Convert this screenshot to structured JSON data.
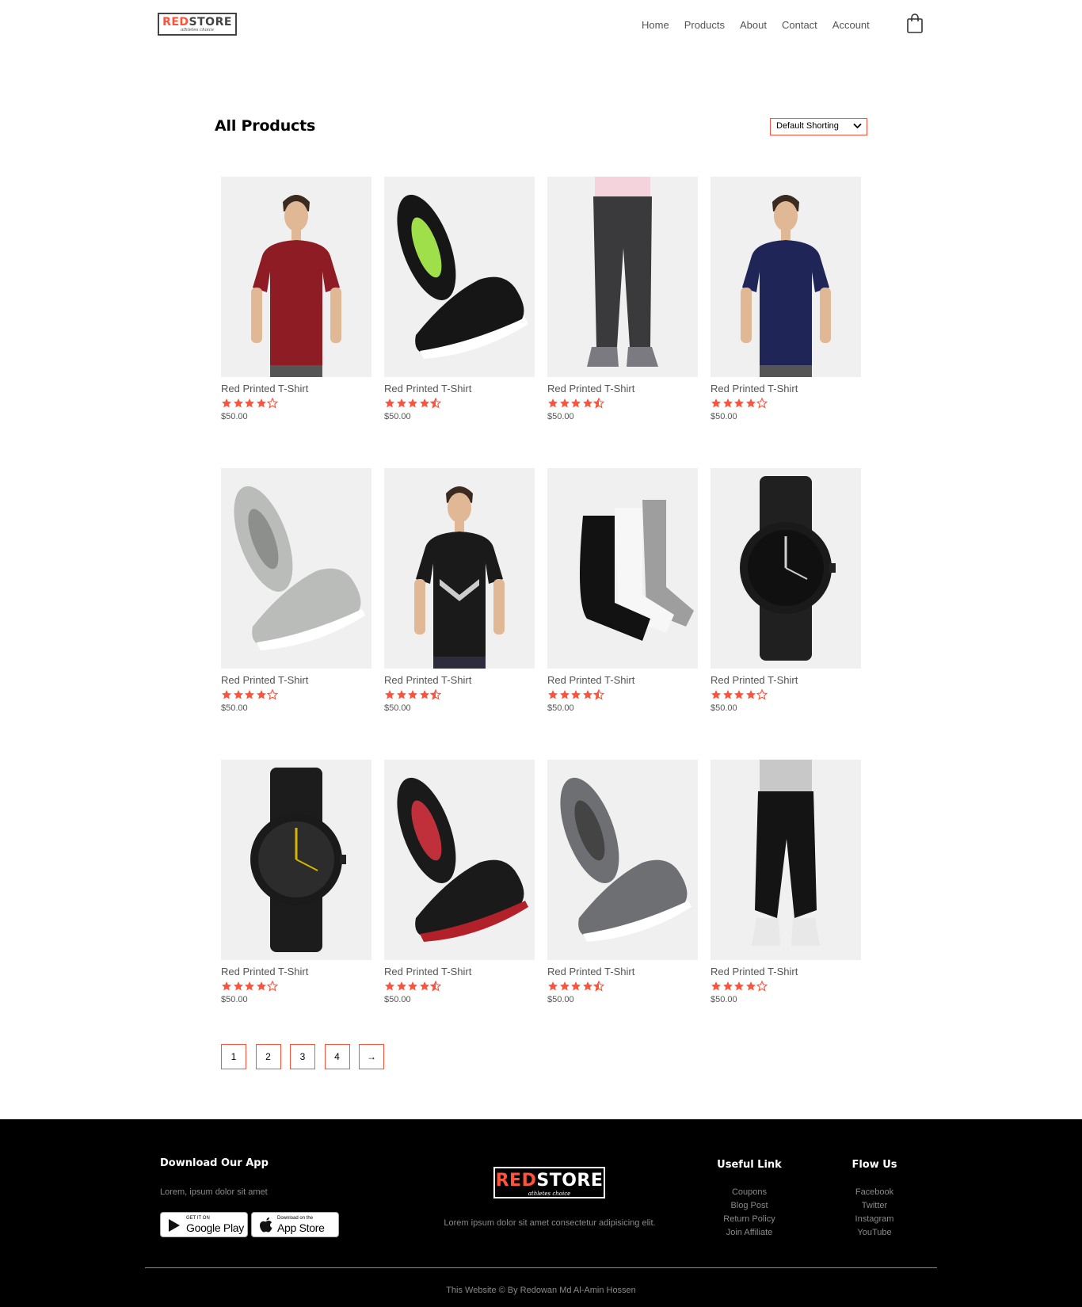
{
  "brand": {
    "logo_text_red": "RED",
    "logo_text_dark": "STORE",
    "tagline": "athletes choice"
  },
  "nav": {
    "links": [
      "Home",
      "Products",
      "About",
      "Contact",
      "Account"
    ],
    "cart_icon": "shopping-bag-icon"
  },
  "page": {
    "title": "All Products",
    "sort": {
      "selected": "Default Shorting"
    }
  },
  "products": [
    {
      "name": "Red Printed T-Shirt",
      "rating": 4,
      "price": "$50.00",
      "image": "red-tshirt-man"
    },
    {
      "name": "Red Printed T-Shirt",
      "rating": 4.5,
      "price": "$50.00",
      "image": "black-hrx-shoes"
    },
    {
      "name": "Red Printed T-Shirt",
      "rating": 4.5,
      "price": "$50.00",
      "image": "grey-trousers"
    },
    {
      "name": "Red Printed T-Shirt",
      "rating": 4,
      "price": "$50.00",
      "image": "navy-polo-man"
    },
    {
      "name": "Red Printed T-Shirt",
      "rating": 4,
      "price": "$50.00",
      "image": "grey-high-top-sneakers"
    },
    {
      "name": "Red Printed T-Shirt",
      "rating": 4.5,
      "price": "$50.00",
      "image": "black-puma-tshirt-man"
    },
    {
      "name": "Red Printed T-Shirt",
      "rating": 4.5,
      "price": "$50.00",
      "image": "hrx-socks"
    },
    {
      "name": "Red Printed T-Shirt",
      "rating": 4,
      "price": "$50.00",
      "image": "black-fossil-watch"
    },
    {
      "name": "Red Printed T-Shirt",
      "rating": 4,
      "price": "$50.00",
      "image": "black-roadster-watch"
    },
    {
      "name": "Red Printed T-Shirt",
      "rating": 4.5,
      "price": "$50.00",
      "image": "black-red-running-shoes"
    },
    {
      "name": "Red Printed T-Shirt",
      "rating": 4.5,
      "price": "$50.00",
      "image": "grey-slip-on-shoes"
    },
    {
      "name": "Red Printed T-Shirt",
      "rating": 4,
      "price": "$50.00",
      "image": "black-joggers"
    }
  ],
  "pagination": {
    "pages": [
      "1",
      "2",
      "3",
      "4"
    ],
    "next": "→"
  },
  "footer": {
    "app": {
      "heading": "Download Our App",
      "text": "Lorem, ipsum dolor sit amet",
      "google_small": "GET IT ON",
      "google_big": "Google Play",
      "apple_small": "Download on the",
      "apple_big": "App Store"
    },
    "center_text": "Lorem ipsum dolor sit amet consectetur adipisicing elit.",
    "useful": {
      "heading": "Useful Link",
      "links": [
        "Coupons",
        "Blog Post",
        "Return Policy",
        "Join Affiliate"
      ]
    },
    "follow": {
      "heading": "Flow Us",
      "links": [
        "Facebook",
        "Twitter",
        "Instagram",
        "YouTube"
      ]
    },
    "copyright": "This Website © By Redowan Md Al-Amin Hossen"
  },
  "colors": {
    "accent": "#ff523b",
    "footer_bg": "#000000",
    "card_bg": "#f0f0f0"
  }
}
